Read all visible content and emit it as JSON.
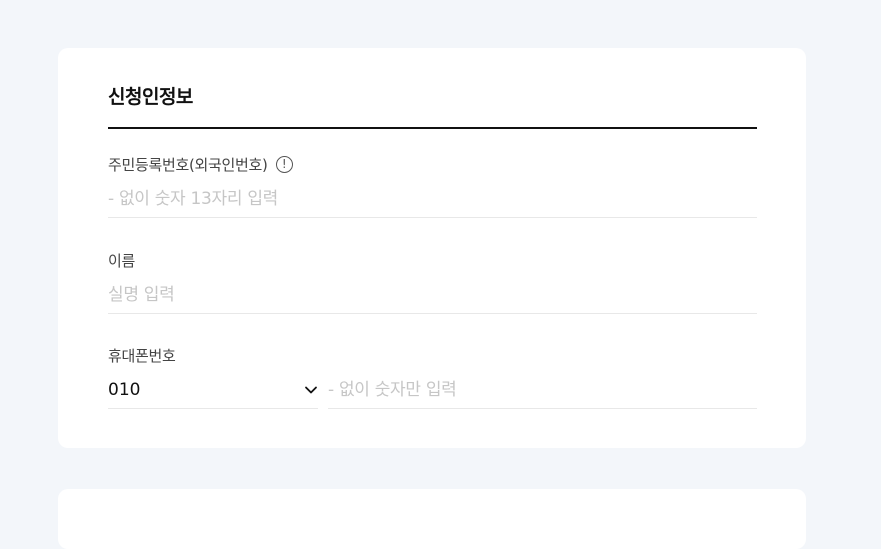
{
  "section": {
    "title": "신청인정보"
  },
  "fields": {
    "resident_id": {
      "label": "주민등록번호(외국인번호)",
      "info_icon_glyph": "!",
      "placeholder": "- 없이 숫자 13자리 입력",
      "value": ""
    },
    "name": {
      "label": "이름",
      "placeholder": "실명 입력",
      "value": ""
    },
    "phone": {
      "label": "휴대폰번호",
      "prefix_selected": "010",
      "placeholder": "- 없이 숫자만 입력",
      "value": ""
    }
  },
  "icons": {
    "info": "info-circle-icon",
    "dropdown": "chevron-down-icon"
  },
  "colors": {
    "background": "#f3f6fa",
    "card": "#ffffff",
    "title": "#111111",
    "label": "#444444",
    "placeholder": "#c6c6c6",
    "divider": "#e8e8e8"
  }
}
